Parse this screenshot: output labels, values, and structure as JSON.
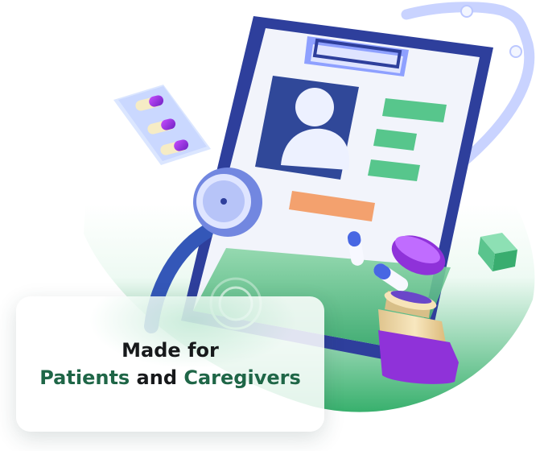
{
  "headline": {
    "line1": "Made for",
    "patients": "Patients",
    "and": " and ",
    "caregivers": "Caregivers"
  },
  "colors": {
    "accent": "#1f6647",
    "text": "#17191b",
    "clipboard": "#2e3f9c",
    "green": "#4fb87c",
    "purple": "#8f32d9",
    "bottle": "#f0d9a6"
  }
}
